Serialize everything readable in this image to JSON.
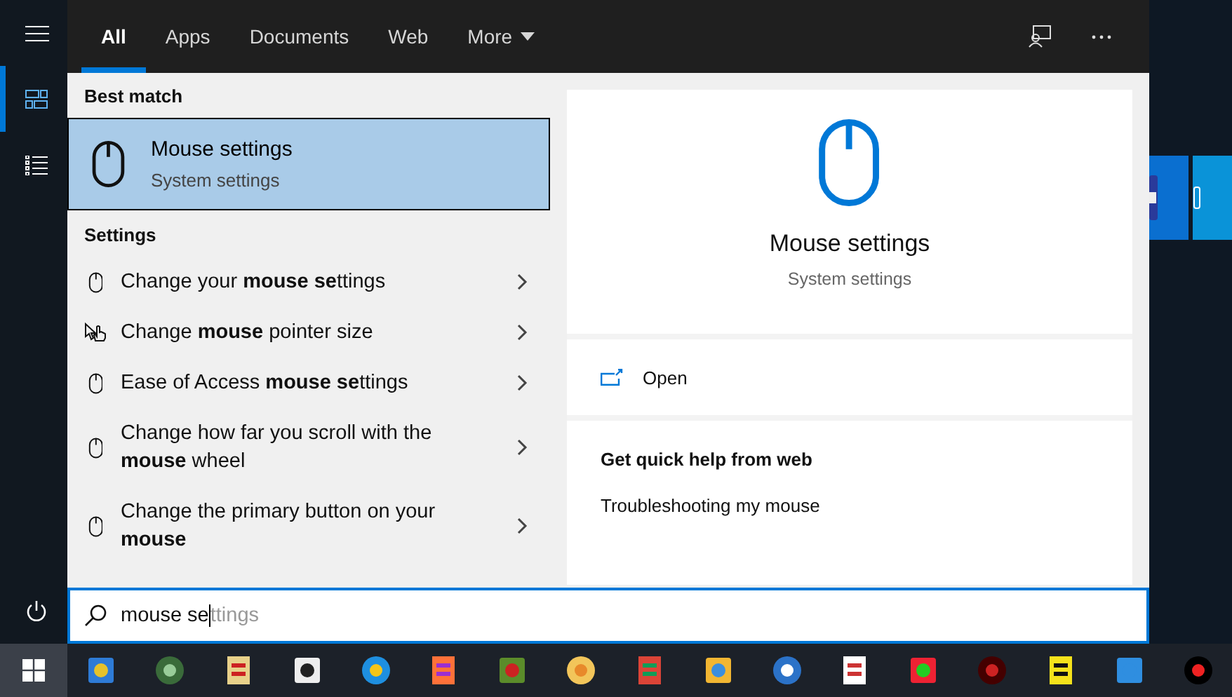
{
  "rail_items": [
    {
      "kind": "home",
      "selected": true
    },
    {
      "kind": "documents",
      "selected": false
    }
  ],
  "tabs": [
    {
      "label": "All",
      "selected": true
    },
    {
      "label": "Apps",
      "selected": false
    },
    {
      "label": "Documents",
      "selected": false
    },
    {
      "label": "Web",
      "selected": false
    },
    {
      "label": "More",
      "selected": false,
      "dropdown": true
    }
  ],
  "best_match": {
    "heading": "Best match",
    "title": "Mouse settings",
    "subtitle": "System settings",
    "selected": true
  },
  "settings": {
    "heading": "Settings",
    "items": [
      {
        "kind": "mouse",
        "text": "Change your **mouse se**ttings"
      },
      {
        "kind": "pointer",
        "text": "Change **mouse** pointer size"
      },
      {
        "kind": "mouse",
        "text": "Ease of Access **mouse se**ttings"
      },
      {
        "kind": "mouse",
        "text": "Change how far you scroll with the **mouse** wheel"
      },
      {
        "kind": "mouse",
        "text": "Change the primary button on your **mouse**"
      }
    ]
  },
  "preview": {
    "title": "Mouse settings",
    "subtitle": "System settings",
    "action": "Open",
    "help_heading": "Get quick help from web",
    "help_link": "Troubleshooting my mouse"
  },
  "search": {
    "value": "mouse se",
    "completion": "ttings"
  }
}
